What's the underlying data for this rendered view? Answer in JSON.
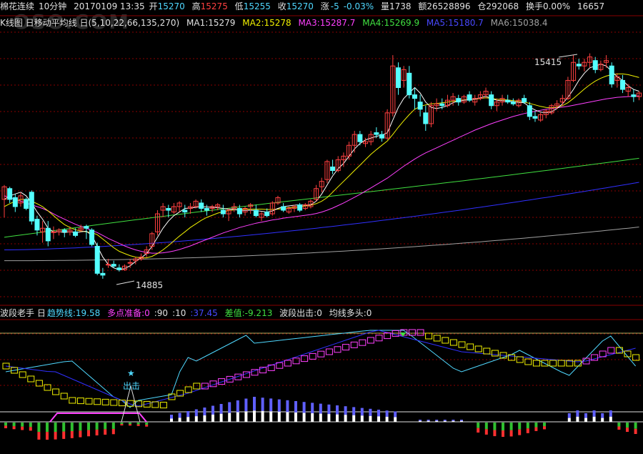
{
  "info": {
    "symbol": "棉花连续",
    "period": "10分钟",
    "datetime": "20170109 13:35",
    "open_label": "开",
    "open": "15270",
    "high_label": "高",
    "high": "15275",
    "low_label": "低",
    "low": "15255",
    "close_label": "收",
    "close": "15270",
    "change_label": "涨",
    "change": "-5",
    "change_pct": "-0.03%",
    "vol_label": "量",
    "vol": "1738",
    "amt_label": "额",
    "amt": "26528896",
    "oi_label": "仓",
    "oi": "292068",
    "turnover_label": "换手",
    "turnover": "0.00%",
    "last": "16657"
  },
  "ma_bar": {
    "title": "K线图 日移动平均线 日(5,10,22,66,135,270)",
    "ma1": "MA1:15279",
    "ma2": "MA2:15278",
    "ma3": "MA3:15287.7",
    "ma4": "MA4:15269.9",
    "ma5": "MA5:15180.7",
    "ma6": "MA6:15038.4"
  },
  "annotations": {
    "high_label": "15415",
    "low_label": "14885"
  },
  "watermark": "OSO.COM",
  "indicator": {
    "name": "波段老手 日",
    "trend": "趋势线:19.58",
    "ready": "多点准备:0",
    "v90": ":90",
    "v10": ":10",
    "v3745": ":37.45",
    "diff": "差值:-9.213",
    "out": "波段出击:0",
    "ma_bull": "均线多头:0",
    "signal_star": "★",
    "signal_text": "出击"
  },
  "colors": {
    "up": "#ff4040",
    "down": "#54ffff",
    "ma1": "#ffffff",
    "ma2": "#f0f000",
    "ma3": "#ff40ff",
    "ma4": "#40e040",
    "ma5": "#3030ff",
    "ma6": "#a0a0a0",
    "grid": "#8a0000"
  },
  "chart_data": {
    "type": "candlestick",
    "candles": [
      [
        15010,
        15050,
        14960,
        15045
      ],
      [
        15040,
        15045,
        15000,
        15010
      ],
      [
        15015,
        15025,
        14975,
        14990
      ],
      [
        15000,
        15030,
        14990,
        15020
      ],
      [
        15010,
        15015,
        14980,
        14985
      ],
      [
        15030,
        15035,
        14940,
        14950
      ],
      [
        14955,
        14965,
        14910,
        14925
      ],
      [
        14920,
        14950,
        14890,
        14930
      ],
      [
        14930,
        14950,
        14880,
        14895
      ],
      [
        14920,
        14935,
        14900,
        14920
      ],
      [
        14920,
        14930,
        14910,
        14925
      ],
      [
        14925,
        14930,
        14905,
        14920
      ],
      [
        14920,
        14935,
        14910,
        14925
      ],
      [
        14920,
        14930,
        14905,
        14910
      ],
      [
        14925,
        14940,
        14920,
        14930
      ],
      [
        14935,
        14940,
        14900,
        14930
      ],
      [
        14925,
        14930,
        14880,
        14885
      ],
      [
        14880,
        14890,
        14800,
        14805
      ],
      [
        14805,
        14820,
        14790,
        14800
      ],
      [
        14830,
        14845,
        14820,
        14830
      ],
      [
        14830,
        14840,
        14820,
        14825
      ],
      [
        14820,
        14830,
        14810,
        14815
      ],
      [
        14815,
        14830,
        14812,
        14825
      ],
      [
        14835,
        14845,
        14820,
        14835
      ],
      [
        14840,
        14850,
        14830,
        14845
      ],
      [
        14845,
        14860,
        14840,
        14850
      ],
      [
        14860,
        14880,
        14850,
        14870
      ],
      [
        14880,
        14920,
        14870,
        14915
      ],
      [
        14920,
        14980,
        14910,
        14970
      ],
      [
        14980,
        15000,
        14960,
        14990
      ],
      [
        14985,
        14995,
        14960,
        14980
      ],
      [
        14975,
        15000,
        14970,
        14990
      ],
      [
        14990,
        15005,
        14975,
        15000
      ],
      [
        14980,
        14995,
        14960,
        14975
      ],
      [
        14985,
        15000,
        14970,
        14990
      ],
      [
        14990,
        15010,
        14985,
        15005
      ],
      [
        15000,
        15010,
        14975,
        14985
      ],
      [
        14985,
        14995,
        14965,
        14980
      ],
      [
        14985,
        14995,
        14975,
        14990
      ],
      [
        14990,
        15000,
        14980,
        14995
      ],
      [
        14980,
        14995,
        14960,
        14970
      ],
      [
        14970,
        14985,
        14950,
        14980
      ],
      [
        14985,
        15000,
        14975,
        14990
      ],
      [
        14985,
        14995,
        14960,
        14970
      ],
      [
        14975,
        14990,
        14965,
        14985
      ],
      [
        14990,
        15000,
        14970,
        14995
      ],
      [
        14980,
        14995,
        14960,
        14965
      ],
      [
        14960,
        14975,
        14950,
        14970
      ],
      [
        14975,
        14985,
        14960,
        14965
      ],
      [
        14970,
        15005,
        14965,
        15000
      ],
      [
        15000,
        15020,
        14995,
        15015
      ],
      [
        14990,
        15000,
        14975,
        14980
      ],
      [
        14975,
        14990,
        14970,
        14985
      ],
      [
        14985,
        14995,
        14975,
        14990
      ],
      [
        14995,
        15000,
        14975,
        14980
      ],
      [
        14985,
        15000,
        14980,
        14995
      ],
      [
        14990,
        15010,
        14985,
        15005
      ],
      [
        15010,
        15050,
        15005,
        15040
      ],
      [
        15045,
        15070,
        15030,
        15060
      ],
      [
        15065,
        15120,
        15055,
        15115
      ],
      [
        15100,
        15120,
        15080,
        15090
      ],
      [
        15090,
        15130,
        15085,
        15120
      ],
      [
        15120,
        15140,
        15100,
        15130
      ],
      [
        15130,
        15170,
        15120,
        15160
      ],
      [
        15160,
        15200,
        15140,
        15190
      ],
      [
        15190,
        15200,
        15160,
        15170
      ],
      [
        15165,
        15180,
        15155,
        15170
      ],
      [
        15170,
        15200,
        15160,
        15190
      ],
      [
        15195,
        15210,
        15180,
        15190
      ],
      [
        15190,
        15200,
        15170,
        15180
      ],
      [
        15180,
        15260,
        15175,
        15250
      ],
      [
        15250,
        15410,
        15240,
        15380
      ],
      [
        15375,
        15390,
        15300,
        15320
      ],
      [
        15340,
        15380,
        15320,
        15370
      ],
      [
        15360,
        15380,
        15290,
        15300
      ],
      [
        15300,
        15320,
        15260,
        15290
      ],
      [
        15280,
        15300,
        15240,
        15260
      ],
      [
        15250,
        15270,
        15200,
        15220
      ],
      [
        15220,
        15280,
        15210,
        15270
      ],
      [
        15270,
        15290,
        15255,
        15275
      ],
      [
        15275,
        15290,
        15260,
        15270
      ],
      [
        15270,
        15300,
        15265,
        15285
      ],
      [
        15285,
        15305,
        15270,
        15295
      ],
      [
        15290,
        15300,
        15270,
        15280
      ],
      [
        15280,
        15300,
        15275,
        15295
      ],
      [
        15300,
        15310,
        15280,
        15285
      ],
      [
        15280,
        15300,
        15270,
        15290
      ],
      [
        15290,
        15310,
        15285,
        15300
      ],
      [
        15300,
        15320,
        15290,
        15310
      ],
      [
        15300,
        15310,
        15260,
        15270
      ],
      [
        15270,
        15290,
        15255,
        15280
      ],
      [
        15280,
        15300,
        15270,
        15290
      ],
      [
        15285,
        15300,
        15275,
        15280
      ],
      [
        15280,
        15290,
        15270,
        15275
      ],
      [
        15270,
        15290,
        15265,
        15285
      ],
      [
        15290,
        15300,
        15275,
        15280
      ],
      [
        15270,
        15280,
        15230,
        15240
      ],
      [
        15240,
        15255,
        15225,
        15235
      ],
      [
        15230,
        15250,
        15225,
        15245
      ],
      [
        15245,
        15260,
        15235,
        15255
      ],
      [
        15250,
        15275,
        15245,
        15270
      ],
      [
        15270,
        15285,
        15260,
        15275
      ],
      [
        15280,
        15300,
        15270,
        15290
      ],
      [
        15290,
        15350,
        15285,
        15340
      ],
      [
        15340,
        15410,
        15335,
        15390
      ],
      [
        15385,
        15400,
        15370,
        15380
      ],
      [
        15380,
        15400,
        15365,
        15390
      ],
      [
        15390,
        15415,
        15375,
        15405
      ],
      [
        15395,
        15405,
        15360,
        15370
      ],
      [
        15370,
        15395,
        15365,
        15385
      ],
      [
        15390,
        15410,
        15375,
        15395
      ],
      [
        15380,
        15390,
        15320,
        15330
      ],
      [
        15340,
        15360,
        15320,
        15350
      ],
      [
        15340,
        15355,
        15305,
        15315
      ],
      [
        15310,
        15330,
        15295,
        15320
      ],
      [
        15300,
        15315,
        15280,
        15295
      ],
      [
        15295,
        15310,
        15285,
        15305
      ]
    ],
    "ma5": [
      15010,
      15020,
      15025,
      15030,
      15020,
      15000,
      14975,
      14955,
      14930,
      14920,
      14920,
      14918,
      14920,
      14918,
      14920,
      14922,
      14910,
      14880,
      14850,
      14830,
      14820,
      14815,
      14818,
      14826,
      14838,
      14848,
      14860,
      14880,
      14905,
      14930,
      14950,
      14965,
      14975,
      14985,
      14986,
      14988,
      14990,
      14989,
      14988,
      14987,
      14985,
      14983,
      14982,
      14980,
      14979,
      14980,
      14979,
      14977,
      14975,
      14978,
      14985,
      14990,
      14992,
      14994,
      14995,
      14994,
      14995,
      15005,
      15025,
      15050,
      15075,
      15095,
      15110,
      15130,
      15150,
      15165,
      15175,
      15180,
      15185,
      15188,
      15195,
      15230,
      15265,
      15290,
      15305,
      15320,
      15305,
      15280,
      15265,
      15262,
      15265,
      15270,
      15278,
      15283,
      15285,
      15287,
      15288,
      15292,
      15296,
      15290,
      15285,
      15284,
      15283,
      15281,
      15279,
      15278,
      15266,
      15258,
      15252,
      15250,
      15253,
      15262,
      15275,
      15293,
      15315,
      15340,
      15360,
      15375,
      15380,
      15385,
      15380,
      15365,
      15350,
      15340,
      15325,
      15315,
      15310
    ],
    "ma10": [
      14990,
      14998,
      15005,
      15010,
      15010,
      15005,
      14998,
      14990,
      14978,
      14965,
      14952,
      14940,
      14932,
      14926,
      14922,
      14920,
      14918,
      14912,
      14900,
      14888,
      14876,
      14866,
      14860,
      14854,
      14850,
      14848,
      14848,
      14852,
      14860,
      14870,
      14882,
      14895,
      14908,
      14920,
      14932,
      14942,
      14952,
      14960,
      14966,
      14972,
      14976,
      14979,
      14981,
      14982,
      14983,
      14983,
      14983,
      14983,
      14982,
      14982,
      14983,
      14985,
      14987,
      14988,
      14990,
      14992,
      14994,
      14998,
      15005,
      15015,
      15030,
      15045,
      15060,
      15075,
      15090,
      15105,
      15120,
      15135,
      15148,
      15160,
      15172,
      15190,
      15210,
      15228,
      15245,
      15260,
      15268,
      15272,
      15275,
      15276,
      15278,
      15280,
      15282,
      15284,
      15286,
      15287,
      15288,
      15290,
      15292,
      15290,
      15288,
      15287,
      15286,
      15284,
      15282,
      15280,
      15276,
      15272,
      15268,
      15265,
      15264,
      15266,
      15270,
      15278,
      15290,
      15303,
      15316,
      15328,
      15338,
      15346,
      15352,
      15356,
      15358,
      15358,
      15356,
      15352,
      15348
    ],
    "ma22": [
      15020,
      15015,
      15010,
      15005,
      15000,
      14995,
      14990,
      14985,
      14978,
      14970,
      14962,
      14955,
      14948,
      14941,
      14935,
      14930,
      14924,
      14918,
      14910,
      14902,
      14895,
      14888,
      14881,
      14875,
      14870,
      14866,
      14863,
      14861,
      14861,
      14862,
      14864,
      14867,
      14871,
      14876,
      14881,
      14887,
      14893,
      14899,
      14905,
      14911,
      14917,
      14922,
      14927,
      14932,
      14936,
      14940,
      14944,
      14947,
      14950,
      14953,
      14955,
      14958,
      14960,
      14962,
      14964,
      14966,
      14968,
      14971,
      14975,
      14980,
      14986,
      14993,
      15000,
      15008,
      15016,
      15024,
      15033,
      15042,
      15051,
      15060,
      15069,
      15080,
      15091,
      15102,
      15112,
      15122,
      15131,
      15139,
      15146,
      15153,
      15160,
      15167,
      15174,
      15181,
      15188,
      15195,
      15202,
      15208,
      15214,
      15220,
      15225,
      15230,
      15235,
      15240,
      15244,
      15248,
      15251,
      15254,
      15257,
      15260,
      15262,
      15264,
      15266,
      15268,
      15271,
      15274,
      15277,
      15280,
      15283,
      15286,
      15289,
      15291,
      15293,
      15294,
      15295,
      15296,
      15297
    ]
  }
}
